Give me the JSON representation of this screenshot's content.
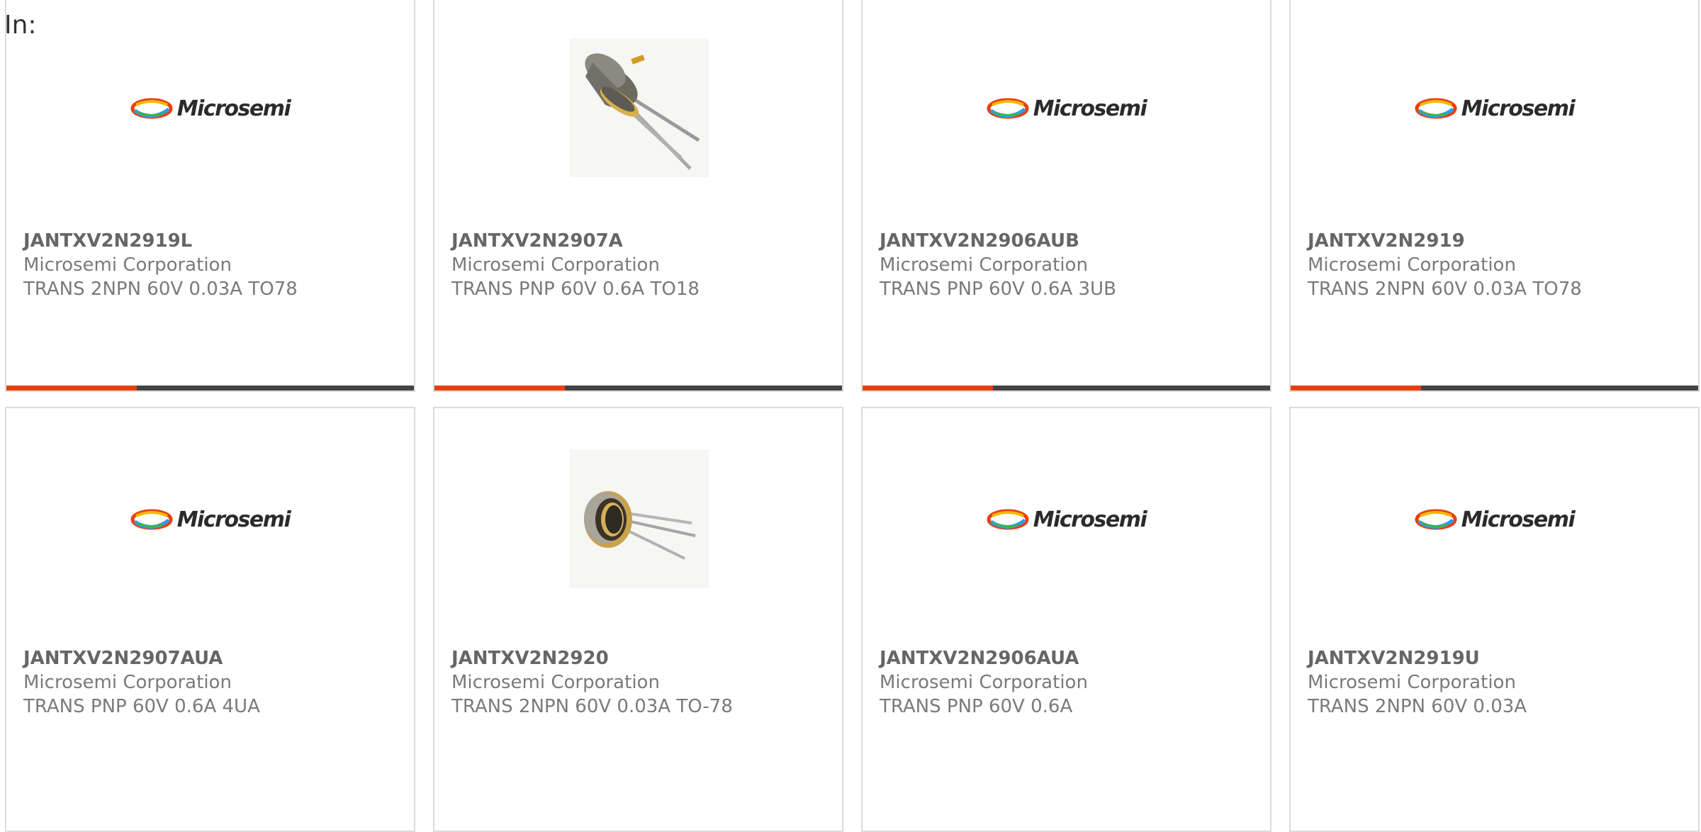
{
  "header": {
    "label": "In:"
  },
  "colors": {
    "accent": "#e8400c",
    "bar_track": "#444444",
    "border": "#dcdcdc",
    "text_primary": "#666666",
    "text_secondary": "#7a7a7a"
  },
  "products": [
    {
      "part_number": "JANTXV2N2919L",
      "manufacturer": "Microsemi Corporation",
      "description": "TRANS 2NPN 60V 0.03A TO78",
      "image": "microsemi-logo",
      "logo_text": "Microsemi",
      "progress": 0.32
    },
    {
      "part_number": "JANTXV2N2907A",
      "manufacturer": "Microsemi Corporation",
      "description": "TRANS PNP 60V 0.6A TO18",
      "image": "transistor-to18-photo",
      "progress": 0.32
    },
    {
      "part_number": "JANTXV2N2906AUB",
      "manufacturer": "Microsemi Corporation",
      "description": "TRANS PNP 60V 0.6A 3UB",
      "image": "microsemi-logo",
      "logo_text": "Microsemi",
      "progress": 0.32
    },
    {
      "part_number": "JANTXV2N2919",
      "manufacturer": "Microsemi Corporation",
      "description": "TRANS 2NPN 60V 0.03A TO78",
      "image": "microsemi-logo",
      "logo_text": "Microsemi",
      "progress": 0.32
    },
    {
      "part_number": "JANTXV2N2907AUA",
      "manufacturer": "Microsemi Corporation",
      "description": "TRANS PNP 60V 0.6A 4UA",
      "image": "microsemi-logo",
      "logo_text": "Microsemi"
    },
    {
      "part_number": "JANTXV2N2920",
      "manufacturer": "Microsemi Corporation",
      "description": "TRANS 2NPN 60V 0.03A TO-78",
      "image": "transistor-to78-photo"
    },
    {
      "part_number": "JANTXV2N2906AUA",
      "manufacturer": "Microsemi Corporation",
      "description": "TRANS PNP 60V 0.6A",
      "image": "microsemi-logo",
      "logo_text": "Microsemi"
    },
    {
      "part_number": "JANTXV2N2919U",
      "manufacturer": "Microsemi Corporation",
      "description": "TRANS 2NPN 60V 0.03A",
      "image": "microsemi-logo",
      "logo_text": "Microsemi"
    }
  ]
}
